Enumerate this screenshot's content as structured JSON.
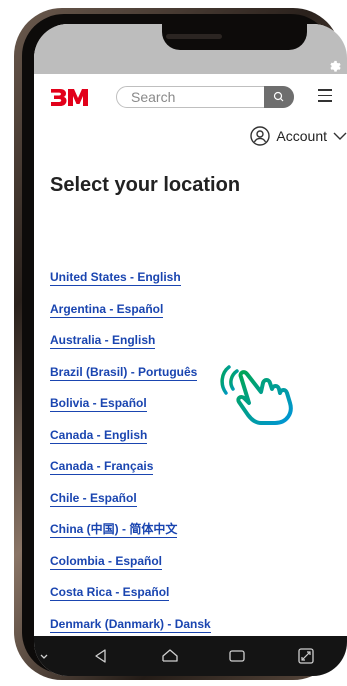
{
  "header": {
    "search_placeholder": "Search",
    "account_label": "Account"
  },
  "page": {
    "title": "Select your location"
  },
  "locations": [
    "United States - English",
    "Argentina - Español",
    "Australia - English",
    "Brazil (Brasil) - Português",
    "Bolivia - Español",
    "Canada - English",
    "Canada - Français",
    "Chile - Español",
    "China (中国) - 简体中文",
    "Colombia - Español",
    "Costa Rica - Español",
    "Denmark (Danmark) - Dansk"
  ],
  "colors": {
    "brand_red": "#e2001a",
    "link_blue": "#1a45b0",
    "hand_gradient_start": "#00a651",
    "hand_gradient_end": "#0095d9"
  },
  "icons": {
    "status": "gear-icon",
    "search": "search-icon",
    "menu": "hamburger-menu-icon",
    "account": "account-avatar-icon",
    "pointer": "pointing-hand-icon"
  }
}
